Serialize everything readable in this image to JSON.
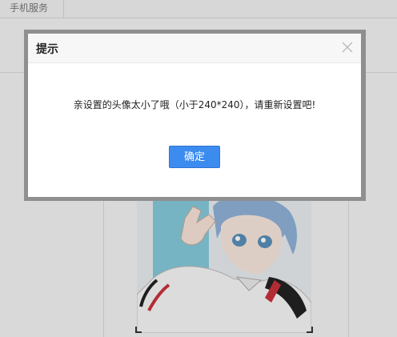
{
  "background": {
    "tab_label": "手机服务"
  },
  "dialog": {
    "title": "提示",
    "message": "亲设置的头像太小了哦（小于240*240），请重新设置吧!",
    "confirm_label": "确定"
  },
  "colors": {
    "confirm_button": "#3c8cf0",
    "dialog_header": "#f7f7f7",
    "dialog_border": "#8f8f8f"
  }
}
